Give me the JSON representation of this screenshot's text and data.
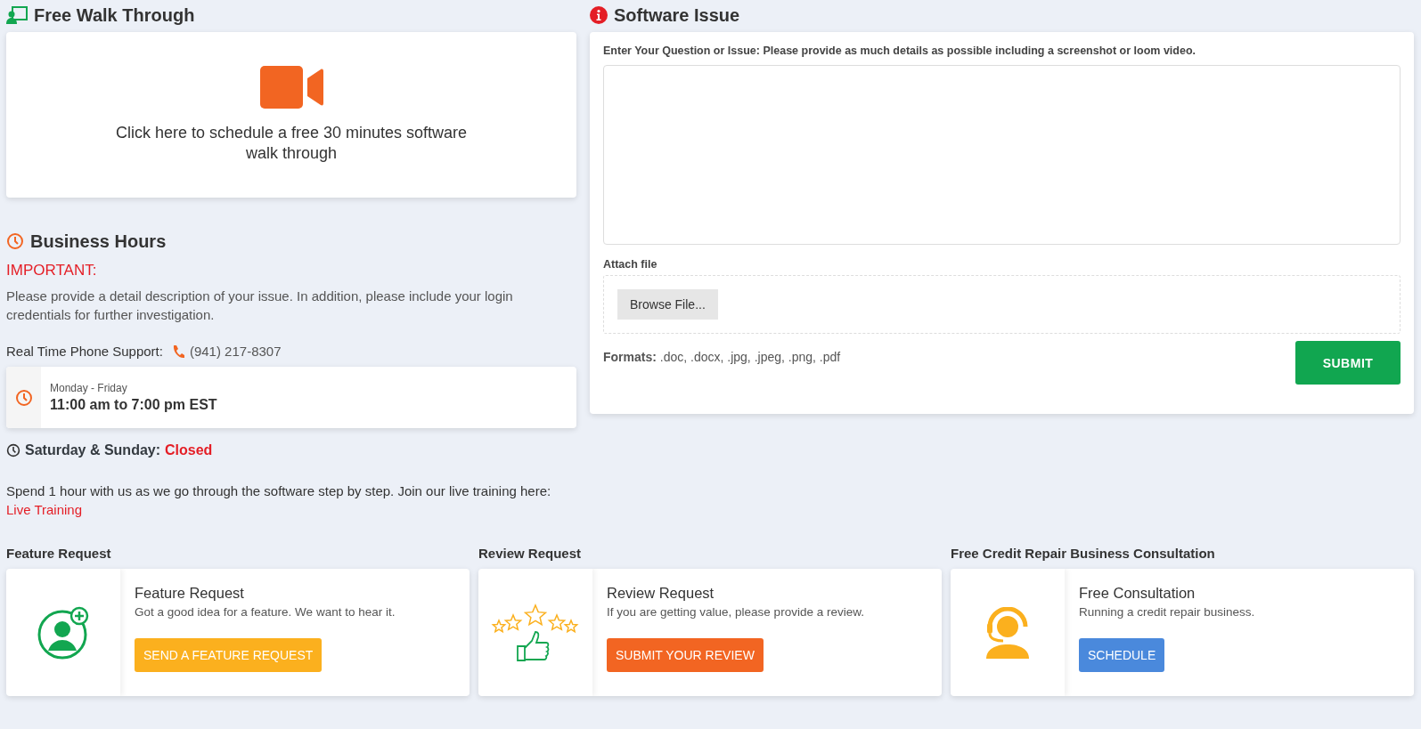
{
  "walkthrough": {
    "title": "Free Walk Through",
    "text": "Click here to schedule a free 30 minutes software walk through"
  },
  "business_hours": {
    "title": "Business Hours",
    "important": "IMPORTANT:",
    "description": "Please provide a detail description of your issue. In addition, please include your login credentials for further investigation.",
    "phone_label": "Real Time Phone Support:",
    "phone": "(941) 217-8307",
    "weekdays": "Monday - Friday",
    "hours": "11:00 am to 7:00 pm EST",
    "weekend_label": "Saturday & Sunday:",
    "weekend_status": "Closed",
    "training_text": "Spend 1 hour with us as we go through the software step by step. Join our live training here:",
    "training_link": "Live Training"
  },
  "software_issue": {
    "title": "Software Issue",
    "question_label": "Enter Your Question or Issue: Please provide as much details as possible including a screenshot or loom video.",
    "attach_label": "Attach file",
    "browse_button": "Browse File...",
    "formats_label": "Formats:",
    "formats": ".doc, .docx, .jpg, .jpeg, .png, .pdf",
    "submit_button": "SUBMIT"
  },
  "cards": [
    {
      "kind": "person-plus",
      "section_title": "Feature Request",
      "title": "Feature Request",
      "description": "Got a good idea for a feature. We want to hear it.",
      "button": "SEND A FEATURE REQUEST",
      "color": "#fbb01e"
    },
    {
      "kind": "stars-thumb",
      "section_title": "Review Request",
      "title": "Review Request",
      "description": "If you are getting value, please provide a review.",
      "button": "SUBMIT YOUR REVIEW",
      "color": "#f26522"
    },
    {
      "kind": "headset",
      "section_title": "Free Credit Repair Business Consultation",
      "title": "Free Consultation",
      "description": "Running a credit repair business.",
      "button": "SCHEDULE",
      "color": "#4a89dc"
    }
  ]
}
